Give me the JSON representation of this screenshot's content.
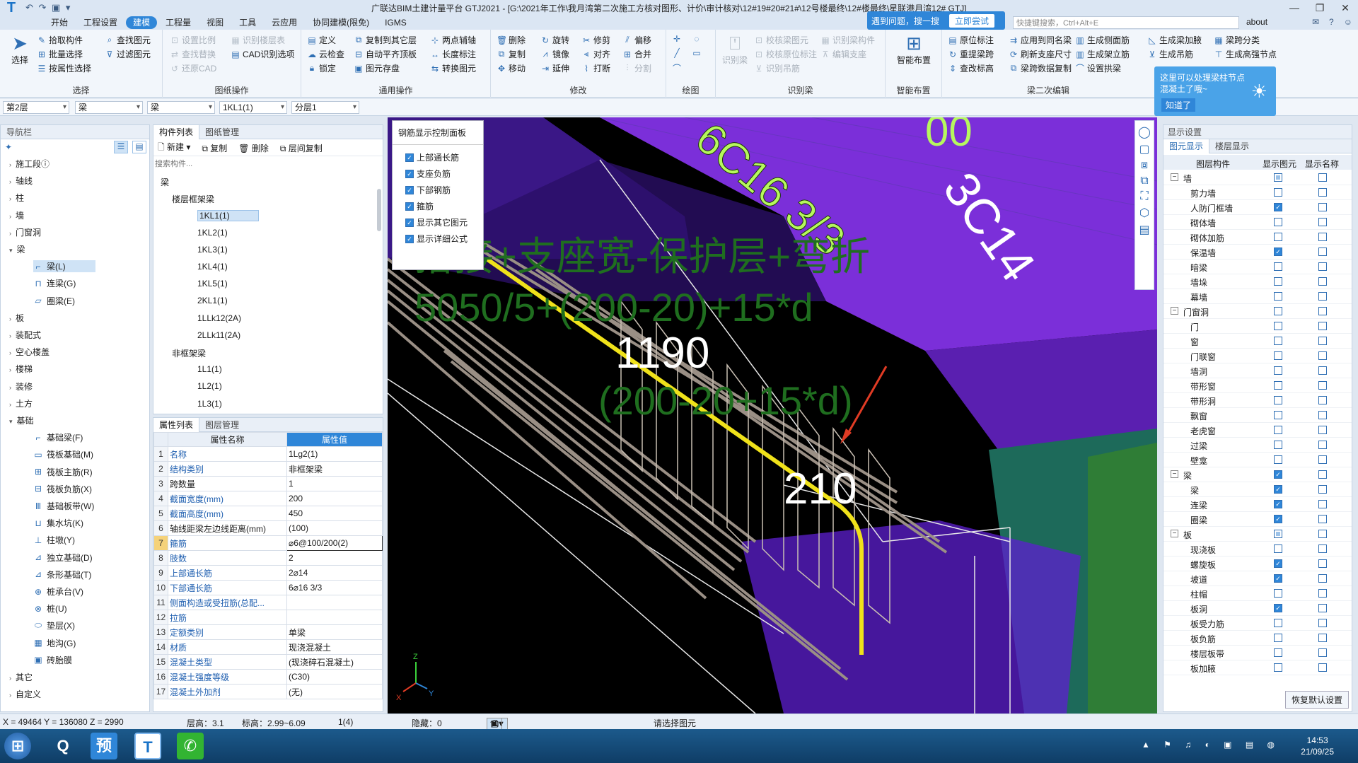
{
  "title_bar": {
    "title": "广联达BIM土建计量平台 GTJ2021 - [G:\\2021年工作\\我月湾第二次施工方核对图形、计价\\审计核对\\12#19#20#21#\\12号楼最终\\12#楼最终\\星联港月湾12# GTJ]",
    "quick_access": "↶ ↷ ▣ ▾"
  },
  "menu": {
    "tabs": [
      "开始",
      "工程设置",
      "建模",
      "工程量",
      "视图",
      "工具",
      "云应用",
      "协同建模(限免)",
      "IGMS"
    ],
    "active": "建模",
    "search_placeholder": "快捷键搜索，Ctrl+Alt+E",
    "about": "about"
  },
  "hint": {
    "text": "遇到问题，搜一搜",
    "button": "立即尝试"
  },
  "ribbon": {
    "select": {
      "label": "选择",
      "big": "选择",
      "items": [
        "拾取构件",
        "批量选择",
        "按属性选择",
        "查找图元",
        "过滤图元"
      ]
    },
    "cad": {
      "label": "图纸操作",
      "items": [
        "设置比例",
        "识别楼层表",
        "查找替换",
        "CAD识别选项",
        "还原CAD"
      ]
    },
    "common": {
      "label": "通用操作",
      "items": [
        "定义",
        "复制到其它层",
        "两点辅轴",
        "云检查",
        "自动平齐顶板",
        "长度标注",
        "锁定",
        "图元存盘",
        "转换图元"
      ]
    },
    "modify": {
      "label": "修改",
      "items": [
        "删除",
        "旋转",
        "修剪",
        "偏移",
        "复制",
        "镜像",
        "对齐",
        "合并",
        "移动",
        "延伸",
        "打断",
        "分割"
      ]
    },
    "draw": {
      "label": "绘图"
    },
    "identify": {
      "label": "识别梁",
      "items": [
        "识别梁",
        "校核梁图元",
        "识别梁构件",
        "校核原位标注",
        "编辑支座",
        "识别吊筋"
      ]
    },
    "smart": {
      "label": "智能布置",
      "big": "智能布置"
    },
    "beam2": {
      "label": "梁二次编辑",
      "items": [
        "原位标注",
        "应用到同名梁",
        "生成侧面筋",
        "生成梁加腋",
        "梁跨分类",
        "重提梁跨",
        "刷新支座尺寸",
        "生成架立筋",
        "生成吊筋",
        "生成高强节点",
        "查改标高",
        "梁跨数据复制",
        "设置拱梁"
      ]
    }
  },
  "bubble": {
    "text": "这里可以处理梁柱节点混凝土了哦~",
    "ok": "知道了"
  },
  "filters": [
    "第2层",
    "梁",
    "梁",
    "1KL1(1)",
    "分层1"
  ],
  "nav": {
    "title": "导航栏",
    "items": [
      {
        "label": "施工段ⓘ",
        "type": "top"
      },
      {
        "label": "轴线",
        "type": "top"
      },
      {
        "label": "柱",
        "type": "top"
      },
      {
        "label": "墙",
        "type": "top"
      },
      {
        "label": "门窗洞",
        "type": "top"
      },
      {
        "label": "梁",
        "type": "top-open"
      },
      {
        "label": "梁(L)",
        "type": "sub",
        "icon": "⌐",
        "selected": true
      },
      {
        "label": "连梁(G)",
        "type": "sub",
        "icon": "⊓"
      },
      {
        "label": "圈梁(E)",
        "type": "sub",
        "icon": "▱"
      },
      {
        "label": "板",
        "type": "top"
      },
      {
        "label": "装配式",
        "type": "top"
      },
      {
        "label": "空心楼盖",
        "type": "top"
      },
      {
        "label": "楼梯",
        "type": "top"
      },
      {
        "label": "装修",
        "type": "top"
      },
      {
        "label": "土方",
        "type": "top"
      },
      {
        "label": "基础",
        "type": "top-open"
      },
      {
        "label": "基础梁(F)",
        "type": "sub",
        "icon": "⌐"
      },
      {
        "label": "筏板基础(M)",
        "type": "sub",
        "icon": "▭"
      },
      {
        "label": "筏板主筋(R)",
        "type": "sub",
        "icon": "⊞"
      },
      {
        "label": "筏板负筋(X)",
        "type": "sub",
        "icon": "⊟"
      },
      {
        "label": "基础板带(W)",
        "type": "sub",
        "icon": "Ⅲ"
      },
      {
        "label": "集水坑(K)",
        "type": "sub",
        "icon": "⊔"
      },
      {
        "label": "柱墩(Y)",
        "type": "sub",
        "icon": "⊥"
      },
      {
        "label": "独立基础(D)",
        "type": "sub",
        "icon": "⊿"
      },
      {
        "label": "条形基础(T)",
        "type": "sub",
        "icon": "⊿"
      },
      {
        "label": "桩承台(V)",
        "type": "sub",
        "icon": "⊕"
      },
      {
        "label": "桩(U)",
        "type": "sub",
        "icon": "⊗"
      },
      {
        "label": "垫层(X)",
        "type": "sub",
        "icon": "⬭"
      },
      {
        "label": "地沟(G)",
        "type": "sub",
        "icon": "▦"
      },
      {
        "label": "砖胎膜",
        "type": "sub",
        "icon": "▣"
      },
      {
        "label": "其它",
        "type": "top"
      },
      {
        "label": "自定义",
        "type": "top"
      }
    ]
  },
  "component_list": {
    "tabs": [
      "构件列表",
      "图纸管理"
    ],
    "toolbar": [
      "新建",
      "复制",
      "删除",
      "层间复制"
    ],
    "search_placeholder": "搜索构件...",
    "tree": {
      "root": "梁",
      "g1": "楼层框架梁",
      "g1_items": [
        "1KL1(1)",
        "1KL2(1)",
        "1KL3(1)",
        "1KL4(1)",
        "1KL5(1)",
        "2KL1(1)",
        "1LLk12(2A)",
        "2LLk11(2A)"
      ],
      "g2": "非框架梁",
      "g2_items": [
        "1L1(1)",
        "1L2(1)",
        "1L3(1)"
      ]
    }
  },
  "properties": {
    "tabs": [
      "属性列表",
      "图层管理"
    ],
    "headers": [
      "属性名称",
      "属性值"
    ],
    "rows": [
      {
        "n": "1",
        "k": "名称",
        "v": "1Lg2(1)"
      },
      {
        "n": "2",
        "k": "结构类别",
        "v": "非框架梁"
      },
      {
        "n": "3",
        "k": "跨数量",
        "v": "1",
        "plain": true
      },
      {
        "n": "4",
        "k": "截面宽度(mm)",
        "v": "200"
      },
      {
        "n": "5",
        "k": "截面高度(mm)",
        "v": "450"
      },
      {
        "n": "6",
        "k": "轴线距梁左边线距离(mm)",
        "v": "(100)",
        "plain": true
      },
      {
        "n": "7",
        "k": "箍筋",
        "v": "⌀6@100/200(2)",
        "hl": true
      },
      {
        "n": "8",
        "k": "肢数",
        "v": "2"
      },
      {
        "n": "9",
        "k": "上部通长筋",
        "v": "2⌀14"
      },
      {
        "n": "10",
        "k": "下部通长筋",
        "v": "6⌀16 3/3"
      },
      {
        "n": "11",
        "k": "侧面构造或受扭筋(总配...",
        "v": ""
      },
      {
        "n": "12",
        "k": "拉筋",
        "v": ""
      },
      {
        "n": "13",
        "k": "定额类别",
        "v": "单梁"
      },
      {
        "n": "14",
        "k": "材质",
        "v": "现浇混凝土"
      },
      {
        "n": "15",
        "k": "混凝土类型",
        "v": "(现浇碎石混凝土)"
      },
      {
        "n": "16",
        "k": "混凝土强度等级",
        "v": "(C30)"
      },
      {
        "n": "17",
        "k": "混凝土外加剂",
        "v": "(无)"
      }
    ]
  },
  "control_panel": {
    "title": "钢筋显示控制面板",
    "items": [
      "上部通长筋",
      "支座负筋",
      "下部钢筋",
      "箍筋",
      "显示其它图元",
      "显示详细公式"
    ]
  },
  "viewport": {
    "formula_line1": "搭接+支座宽-保护层+弯折",
    "formula_line2": "5050/5+(200-20)+15*d",
    "dim_1190": "1190",
    "dim_1190_formula": "(200-20+15*d)",
    "dim_210": "210",
    "green_text": "6C16 3/3",
    "white_text": "3C14",
    "top_text": "00",
    "colors": {
      "purple": "#7b2fd9",
      "green_label": "#b6f75e",
      "formula": "#1f6e1f",
      "rebar_highlight": "#f0e21a",
      "arrow": "#e03b24"
    }
  },
  "display_settings": {
    "title": "显示设置",
    "tabs": [
      "图元显示",
      "楼层显示"
    ],
    "headers": [
      "图层构件",
      "显示图元",
      "显示名称"
    ],
    "rows": [
      {
        "name": "墙",
        "group": true,
        "c1": "part",
        "c2": false
      },
      {
        "name": "剪力墙",
        "c1": false,
        "c2": false
      },
      {
        "name": "人防门框墙",
        "c1": true,
        "c2": false
      },
      {
        "name": "砌体墙",
        "c1": false,
        "c2": false
      },
      {
        "name": "砌体加筋",
        "c1": false,
        "c2": false
      },
      {
        "name": "保温墙",
        "c1": true,
        "c2": false
      },
      {
        "name": "暗梁",
        "c1": false,
        "c2": false
      },
      {
        "name": "墙垛",
        "c1": false,
        "c2": false
      },
      {
        "name": "幕墙",
        "c1": false,
        "c2": false
      },
      {
        "name": "门窗洞",
        "group": true,
        "c1": false,
        "c2": false
      },
      {
        "name": "门",
        "c1": false,
        "c2": false
      },
      {
        "name": "窗",
        "c1": false,
        "c2": false
      },
      {
        "name": "门联窗",
        "c1": false,
        "c2": false
      },
      {
        "name": "墙洞",
        "c1": false,
        "c2": false
      },
      {
        "name": "带形窗",
        "c1": false,
        "c2": false
      },
      {
        "name": "带形洞",
        "c1": false,
        "c2": false
      },
      {
        "name": "飘窗",
        "c1": false,
        "c2": false
      },
      {
        "name": "老虎窗",
        "c1": false,
        "c2": false
      },
      {
        "name": "过梁",
        "c1": false,
        "c2": false
      },
      {
        "name": "壁龛",
        "c1": false,
        "c2": false
      },
      {
        "name": "梁",
        "group": true,
        "c1": true,
        "c2": false
      },
      {
        "name": "梁",
        "c1": true,
        "c2": false
      },
      {
        "name": "连梁",
        "c1": true,
        "c2": false
      },
      {
        "name": "圈梁",
        "c1": true,
        "c2": false
      },
      {
        "name": "板",
        "group": true,
        "c1": "part",
        "c2": false
      },
      {
        "name": "现浇板",
        "c1": false,
        "c2": false
      },
      {
        "name": "螺旋板",
        "c1": true,
        "c2": false
      },
      {
        "name": "坡道",
        "c1": true,
        "c2": false
      },
      {
        "name": "柱帽",
        "c1": false,
        "c2": false
      },
      {
        "name": "板洞",
        "c1": true,
        "c2": false
      },
      {
        "name": "板受力筋",
        "c1": false,
        "c2": false
      },
      {
        "name": "板负筋",
        "c1": false,
        "c2": false
      },
      {
        "name": "楼层板带",
        "c1": false,
        "c2": false
      },
      {
        "name": "板加腋",
        "c1": false,
        "c2": false
      }
    ],
    "reset": "恢复默认设置"
  },
  "status": {
    "coords": "X = 49464 Y = 136080 Z = 2990",
    "floor_height": "层高：3.1",
    "elevation": "标高：2.99~6.09",
    "count": "1(4)",
    "hidden": "隐藏：0",
    "prompt": "请选择图元"
  },
  "taskbar": {
    "time": "14:53",
    "date": "21/09/25",
    "apps": [
      "⊞",
      "Q",
      "预",
      "T",
      "✆"
    ]
  }
}
